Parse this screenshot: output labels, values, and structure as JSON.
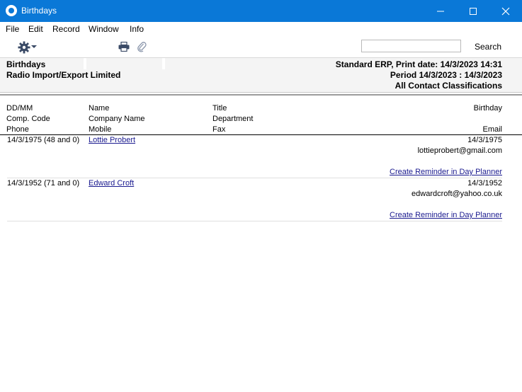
{
  "window": {
    "title": "Birthdays"
  },
  "menu": [
    "File",
    "Edit",
    "Record",
    "Window",
    "Info"
  ],
  "toolbar": {
    "search_placeholder": "",
    "search_label": "Search"
  },
  "report": {
    "left_lines": [
      "Birthdays",
      "Radio Import/Export Limited"
    ],
    "right_lines": [
      "Standard ERP, Print date: 14/3/2023 14:31",
      "Period  14/3/2023 : 14/3/2023",
      "All Contact Classifications"
    ]
  },
  "columns": {
    "col1": [
      "DD/MM",
      "Comp. Code",
      "Phone"
    ],
    "col2": [
      "Name",
      "Company Name",
      "Mobile"
    ],
    "col3": [
      "Title",
      "Department",
      "Fax"
    ],
    "col4": [
      "Birthday",
      "",
      "Email"
    ]
  },
  "records": [
    {
      "dd": "14/3/1975 (48 and 0)",
      "name": "Lottie Probert",
      "birthday": "14/3/1975",
      "email": "lottieprobert@gmail.com",
      "action": "Create Reminder in Day Planner"
    },
    {
      "dd": "14/3/1952 (71 and 0)",
      "name": "Edward Croft",
      "birthday": "14/3/1952",
      "email": "edwardcroft@yahoo.co.uk",
      "action": "Create Reminder in Day Planner"
    }
  ],
  "colors": {
    "titlebar": "#0a78d7",
    "link": "#1a1a8f",
    "header_bg": "#f4f4f4"
  },
  "icons": [
    "app-logo-icon",
    "minimize-icon",
    "maximize-icon",
    "close-icon",
    "gear-icon",
    "print-icon",
    "paperclip-icon"
  ]
}
